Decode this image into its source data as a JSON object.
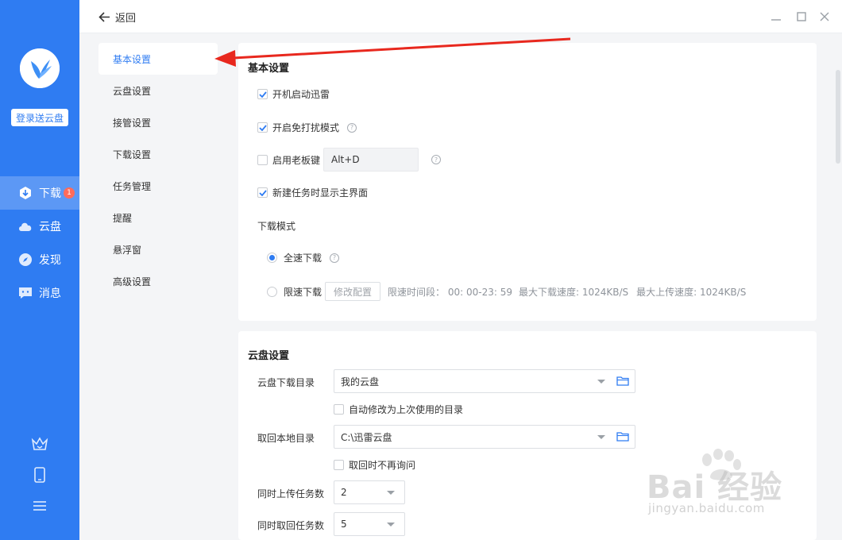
{
  "sidebar": {
    "login_label": "登录送云盘",
    "nav": [
      {
        "label": "下载",
        "icon": "download-icon",
        "badge": "1",
        "active": true
      },
      {
        "label": "云盘",
        "icon": "cloud-icon"
      },
      {
        "label": "发现",
        "icon": "compass-icon"
      },
      {
        "label": "消息",
        "icon": "message-icon"
      }
    ],
    "bottom_icons": [
      "crown-icon",
      "phone-icon",
      "menu-icon"
    ]
  },
  "topbar": {
    "back_label": "返回",
    "window_buttons": [
      "minimize-icon",
      "maximize-icon",
      "close-icon"
    ]
  },
  "settings_menu": {
    "items": [
      "基本设置",
      "云盘设置",
      "接管设置",
      "下载设置",
      "任务管理",
      "提醒",
      "悬浮窗",
      "高级设置"
    ],
    "active_index": 0
  },
  "basic": {
    "title": "基本设置",
    "autostart": {
      "label": "开机启动迅雷",
      "checked": true
    },
    "dnd": {
      "label": "开启免打扰模式",
      "checked": true
    },
    "boss_key": {
      "label": "启用老板键",
      "checked": false,
      "value": "Alt+D"
    },
    "show_main": {
      "label": "新建任务时显示主界面",
      "checked": true
    },
    "mode_title": "下载模式",
    "mode_full": {
      "label": "全速下载",
      "selected": true
    },
    "mode_limit": {
      "label": "限速下载",
      "selected": false,
      "config_button": "修改配置",
      "time_text": "限速时间段： 00: 00-23: 59",
      "max_down_text": "最大下载速度: 1024KB/S",
      "max_up_text": "最大上传速度: 1024KB/S"
    }
  },
  "cloud": {
    "title": "云盘设置",
    "download_dir": {
      "label": "云盘下载目录",
      "value": "我的云盘",
      "auto_label": "自动修改为上次使用的目录",
      "auto_checked": false
    },
    "local_dir": {
      "label": "取回本地目录",
      "value": "C:\\迅雷云盘",
      "noask_label": "取回时不再询问",
      "noask_checked": false
    },
    "upload_count": {
      "label": "同时上传任务数",
      "value": "2"
    },
    "retrieve_count": {
      "label": "同时取回任务数",
      "value": "5"
    }
  },
  "watermark": {
    "main": "Bai 经验",
    "sub": "jingyan.baidu.com"
  },
  "colors": {
    "accent": "#2f7cf2",
    "arrow": "#e8281e",
    "badge": "#ff6b5a"
  }
}
